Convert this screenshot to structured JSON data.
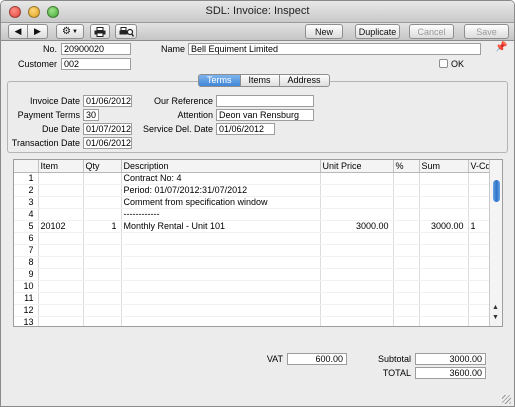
{
  "window": {
    "title": "SDL: Invoice: Inspect"
  },
  "toolbar": {
    "new_label": "New",
    "duplicate_label": "Duplicate",
    "cancel_label": "Cancel",
    "save_label": "Save"
  },
  "header": {
    "no_label": "No.",
    "no_value": "20900020",
    "customer_label": "Customer",
    "customer_value": "002",
    "name_label": "Name",
    "name_value": "Bell Equiment Limited",
    "ok_label": "OK"
  },
  "tabs": [
    "Terms",
    "Items",
    "Address"
  ],
  "terms": {
    "invoice_date_label": "Invoice Date",
    "invoice_date": "01/06/2012",
    "payment_terms_label": "Payment Terms",
    "payment_terms": "30",
    "due_date_label": "Due Date",
    "due_date": "01/07/2012",
    "transaction_date_label": "Transaction Date",
    "transaction_date": "01/06/2012",
    "our_reference_label": "Our Reference",
    "our_reference": "",
    "attention_label": "Attention",
    "attention": "Deon van Rensburg",
    "service_del_date_label": "Service Del. Date",
    "service_del_date": "01/06/2012"
  },
  "grid": {
    "columns": [
      "",
      "Item",
      "Qty",
      "Description",
      "Unit Price",
      "%",
      "Sum",
      "V-Cd"
    ],
    "rows": [
      [
        "1",
        "",
        "",
        "Contract No: 4",
        "",
        "",
        "",
        ""
      ],
      [
        "2",
        "",
        "",
        "Period: 01/07/2012:31/07/2012",
        "",
        "",
        "",
        ""
      ],
      [
        "3",
        "",
        "",
        "Comment from specification window",
        "",
        "",
        "",
        ""
      ],
      [
        "4",
        "",
        "",
        "------------",
        "",
        "",
        "",
        ""
      ],
      [
        "5",
        "20102",
        "1",
        "Monthly Rental - Unit 101",
        "3000.00",
        "",
        "3000.00",
        "1"
      ],
      [
        "6",
        "",
        "",
        "",
        "",
        "",
        "",
        ""
      ],
      [
        "7",
        "",
        "",
        "",
        "",
        "",
        "",
        ""
      ],
      [
        "8",
        "",
        "",
        "",
        "",
        "",
        "",
        ""
      ],
      [
        "9",
        "",
        "",
        "",
        "",
        "",
        "",
        ""
      ],
      [
        "10",
        "",
        "",
        "",
        "",
        "",
        "",
        ""
      ],
      [
        "11",
        "",
        "",
        "",
        "",
        "",
        "",
        ""
      ],
      [
        "12",
        "",
        "",
        "",
        "",
        "",
        "",
        ""
      ],
      [
        "13",
        "",
        "",
        "",
        "",
        "",
        "",
        ""
      ]
    ]
  },
  "footer": {
    "vat_label": "VAT",
    "vat_value": "600.00",
    "subtotal_label": "Subtotal",
    "subtotal_value": "3000.00",
    "total_label": "TOTAL",
    "total_value": "3600.00"
  }
}
